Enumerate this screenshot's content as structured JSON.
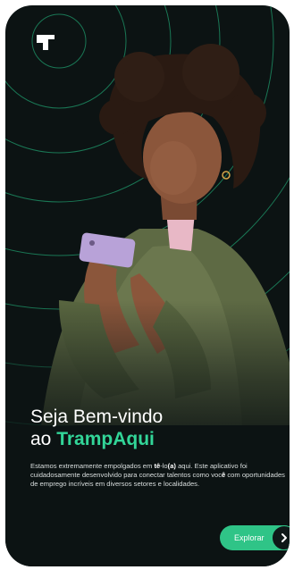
{
  "app": {
    "logo_icon": "trampaqui-logo-icon"
  },
  "welcome": {
    "line1": "Seja Bem-vindo",
    "line2_prefix": "ao ",
    "brand_name": "TrampAqui",
    "description_part1": "Estamos extremamente empolgados em ",
    "description_bold1": "tê",
    "description_part2": "-lo",
    "description_bold2": "(a)",
    "description_part3": " aqui. Este aplicativo foi cuidadosamente desenvolvido para conectar talentos como voc",
    "description_bold3": "ê",
    "description_part4": " com oportunidades de emprego incríveis em diversos setores e localidades."
  },
  "cta": {
    "label": "Explorar",
    "icon": "chevron-right-icon"
  },
  "colors": {
    "background": "#0c1313",
    "accent": "#32d598",
    "button": "#2fc487"
  }
}
